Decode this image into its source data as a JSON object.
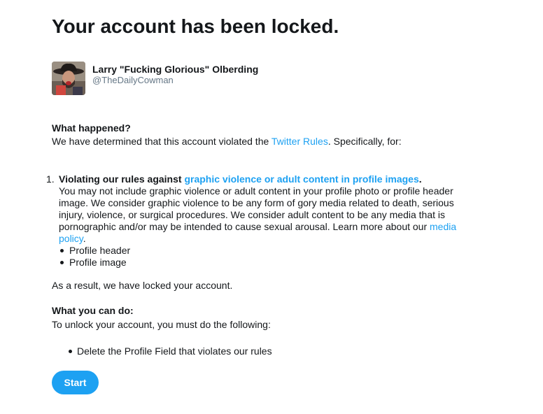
{
  "page": {
    "title": "Your account has been locked."
  },
  "profile": {
    "name": "Larry \"Fucking Glorious\" Olberding",
    "handle": "@TheDailyCowman",
    "avatar_icon": "cowboy-avatar"
  },
  "what_happened": {
    "heading": "What happened?",
    "text_before": "We have determined that this account violated the ",
    "rules_link": "Twitter Rules",
    "text_after": ". Specifically, for:"
  },
  "violations": [
    {
      "number": "1.",
      "title_prefix": "Violating our rules against ",
      "title_link": "graphic violence or adult content in profile images",
      "title_suffix": ".",
      "description_lines": [
        "You may not include graphic violence or adult content in your profile photo or profile header",
        "image. We consider graphic violence to be any form of gory media related to death, serious",
        "injury, violence, or surgical procedures. We consider adult content to be any media that is",
        "pornographic and/or may be intended to cause sexual arousal. Learn more about our "
      ],
      "policy_link_part1": "media",
      "policy_link_part2": "policy",
      "policy_suffix": ".",
      "items": [
        "Profile header",
        "Profile image"
      ]
    }
  ],
  "result": {
    "text": "As a result, we have locked your account."
  },
  "what_you_can_do": {
    "heading": "What you can do:",
    "text": "To unlock your account, you must do the following:",
    "items": [
      "Delete the Profile Field that violates our rules"
    ]
  },
  "actions": {
    "start_label": "Start"
  },
  "colors": {
    "link": "#1da1f2",
    "text": "#14171a",
    "secondary_text": "#657786",
    "button_bg": "#1da1f2",
    "button_text": "#ffffff"
  }
}
